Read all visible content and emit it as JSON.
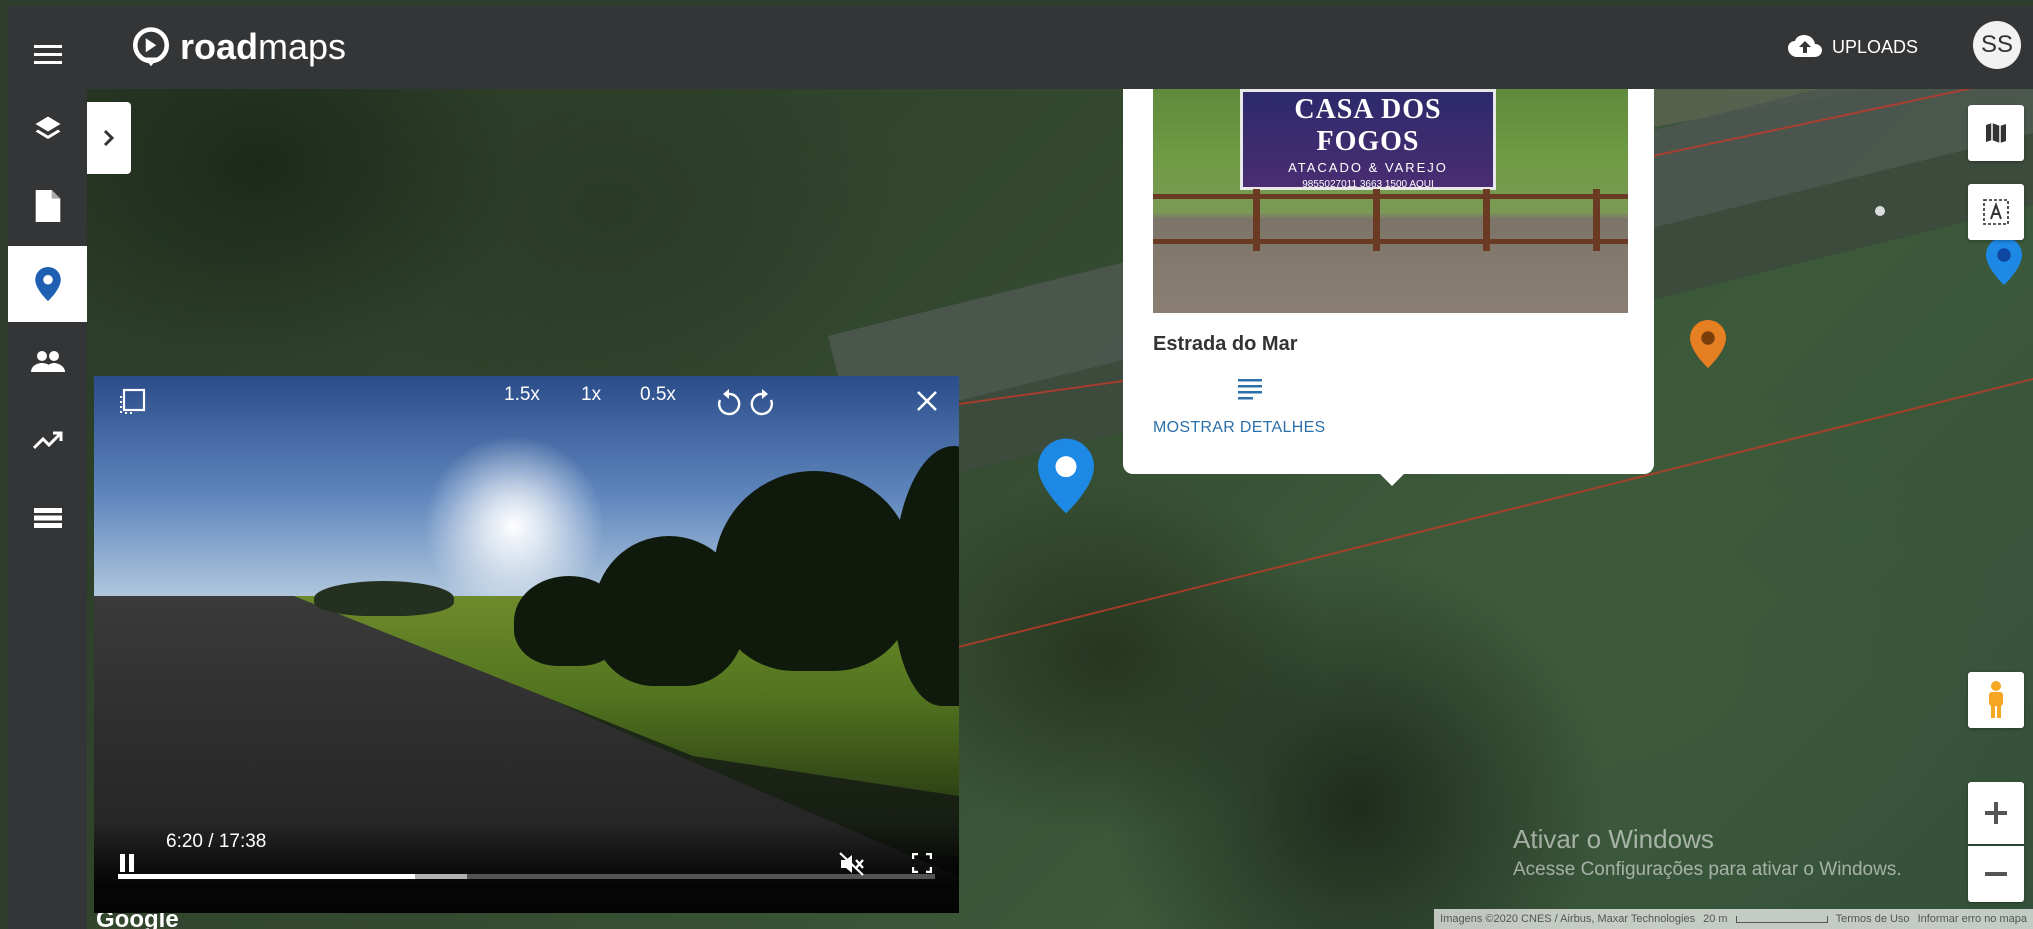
{
  "app": {
    "logo_bold": "road",
    "logo_regular": "maps"
  },
  "header": {
    "uploads_label": "UPLOADS",
    "avatar_initials": "SS"
  },
  "sidebar": {
    "items": [
      {
        "icon": "menu-icon",
        "active": false
      },
      {
        "icon": "layers-icon",
        "active": false
      },
      {
        "icon": "file-icon",
        "active": false
      },
      {
        "icon": "place-icon",
        "active": true
      },
      {
        "icon": "people-icon",
        "active": false
      },
      {
        "icon": "trending-up-icon",
        "active": false
      },
      {
        "icon": "list-icon",
        "active": false
      }
    ]
  },
  "popup": {
    "billboard_line1": "CASA DOS FOGOS",
    "billboard_line2": "ATACADO & VAREJO",
    "billboard_line3": "9855027011 3663 1500 AQUI",
    "title": "Estrada do Mar",
    "details_label": "MOSTRAR DETALHES"
  },
  "player": {
    "speeds": [
      "1.5x",
      "1x",
      "0.5x"
    ],
    "time": "6:20 / 17:38",
    "progress": 0.364,
    "buffered": 0.427
  },
  "map": {
    "google_label": "Google",
    "watermark_title": "Ativar o Windows",
    "watermark_sub": "Acesse Configurações para ativar o Windows.",
    "attribution": "Imagens ©2020 CNES / Airbus, Maxar Technologies",
    "scale": "20 m",
    "terms": "Termos de Uso",
    "report": "Informar erro no mapa"
  },
  "colors": {
    "bar_bg": "#333537",
    "accent_blue": "#1e88e5",
    "pin_orange": "#e67e22",
    "link": "#2d6fa8"
  }
}
